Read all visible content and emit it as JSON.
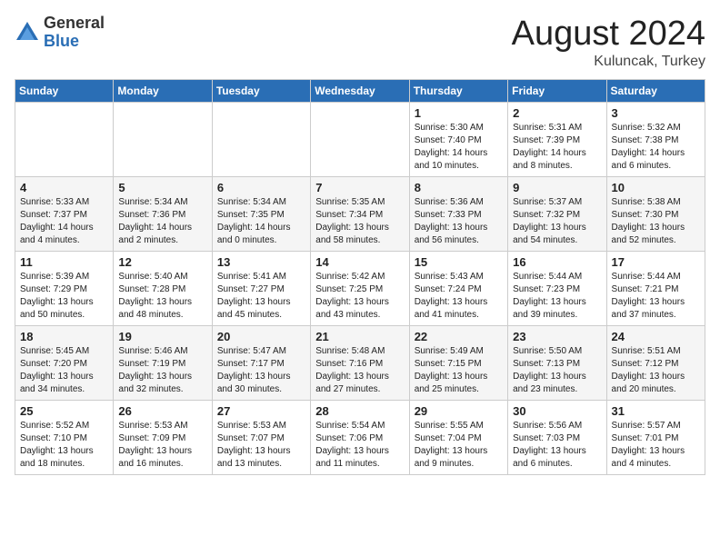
{
  "header": {
    "logo_general": "General",
    "logo_blue": "Blue",
    "month_year": "August 2024",
    "location": "Kuluncak, Turkey"
  },
  "days_of_week": [
    "Sunday",
    "Monday",
    "Tuesday",
    "Wednesday",
    "Thursday",
    "Friday",
    "Saturday"
  ],
  "weeks": [
    [
      {
        "day": "",
        "info": ""
      },
      {
        "day": "",
        "info": ""
      },
      {
        "day": "",
        "info": ""
      },
      {
        "day": "",
        "info": ""
      },
      {
        "day": "1",
        "info": "Sunrise: 5:30 AM\nSunset: 7:40 PM\nDaylight: 14 hours\nand 10 minutes."
      },
      {
        "day": "2",
        "info": "Sunrise: 5:31 AM\nSunset: 7:39 PM\nDaylight: 14 hours\nand 8 minutes."
      },
      {
        "day": "3",
        "info": "Sunrise: 5:32 AM\nSunset: 7:38 PM\nDaylight: 14 hours\nand 6 minutes."
      }
    ],
    [
      {
        "day": "4",
        "info": "Sunrise: 5:33 AM\nSunset: 7:37 PM\nDaylight: 14 hours\nand 4 minutes."
      },
      {
        "day": "5",
        "info": "Sunrise: 5:34 AM\nSunset: 7:36 PM\nDaylight: 14 hours\nand 2 minutes."
      },
      {
        "day": "6",
        "info": "Sunrise: 5:34 AM\nSunset: 7:35 PM\nDaylight: 14 hours\nand 0 minutes."
      },
      {
        "day": "7",
        "info": "Sunrise: 5:35 AM\nSunset: 7:34 PM\nDaylight: 13 hours\nand 58 minutes."
      },
      {
        "day": "8",
        "info": "Sunrise: 5:36 AM\nSunset: 7:33 PM\nDaylight: 13 hours\nand 56 minutes."
      },
      {
        "day": "9",
        "info": "Sunrise: 5:37 AM\nSunset: 7:32 PM\nDaylight: 13 hours\nand 54 minutes."
      },
      {
        "day": "10",
        "info": "Sunrise: 5:38 AM\nSunset: 7:30 PM\nDaylight: 13 hours\nand 52 minutes."
      }
    ],
    [
      {
        "day": "11",
        "info": "Sunrise: 5:39 AM\nSunset: 7:29 PM\nDaylight: 13 hours\nand 50 minutes."
      },
      {
        "day": "12",
        "info": "Sunrise: 5:40 AM\nSunset: 7:28 PM\nDaylight: 13 hours\nand 48 minutes."
      },
      {
        "day": "13",
        "info": "Sunrise: 5:41 AM\nSunset: 7:27 PM\nDaylight: 13 hours\nand 45 minutes."
      },
      {
        "day": "14",
        "info": "Sunrise: 5:42 AM\nSunset: 7:25 PM\nDaylight: 13 hours\nand 43 minutes."
      },
      {
        "day": "15",
        "info": "Sunrise: 5:43 AM\nSunset: 7:24 PM\nDaylight: 13 hours\nand 41 minutes."
      },
      {
        "day": "16",
        "info": "Sunrise: 5:44 AM\nSunset: 7:23 PM\nDaylight: 13 hours\nand 39 minutes."
      },
      {
        "day": "17",
        "info": "Sunrise: 5:44 AM\nSunset: 7:21 PM\nDaylight: 13 hours\nand 37 minutes."
      }
    ],
    [
      {
        "day": "18",
        "info": "Sunrise: 5:45 AM\nSunset: 7:20 PM\nDaylight: 13 hours\nand 34 minutes."
      },
      {
        "day": "19",
        "info": "Sunrise: 5:46 AM\nSunset: 7:19 PM\nDaylight: 13 hours\nand 32 minutes."
      },
      {
        "day": "20",
        "info": "Sunrise: 5:47 AM\nSunset: 7:17 PM\nDaylight: 13 hours\nand 30 minutes."
      },
      {
        "day": "21",
        "info": "Sunrise: 5:48 AM\nSunset: 7:16 PM\nDaylight: 13 hours\nand 27 minutes."
      },
      {
        "day": "22",
        "info": "Sunrise: 5:49 AM\nSunset: 7:15 PM\nDaylight: 13 hours\nand 25 minutes."
      },
      {
        "day": "23",
        "info": "Sunrise: 5:50 AM\nSunset: 7:13 PM\nDaylight: 13 hours\nand 23 minutes."
      },
      {
        "day": "24",
        "info": "Sunrise: 5:51 AM\nSunset: 7:12 PM\nDaylight: 13 hours\nand 20 minutes."
      }
    ],
    [
      {
        "day": "25",
        "info": "Sunrise: 5:52 AM\nSunset: 7:10 PM\nDaylight: 13 hours\nand 18 minutes."
      },
      {
        "day": "26",
        "info": "Sunrise: 5:53 AM\nSunset: 7:09 PM\nDaylight: 13 hours\nand 16 minutes."
      },
      {
        "day": "27",
        "info": "Sunrise: 5:53 AM\nSunset: 7:07 PM\nDaylight: 13 hours\nand 13 minutes."
      },
      {
        "day": "28",
        "info": "Sunrise: 5:54 AM\nSunset: 7:06 PM\nDaylight: 13 hours\nand 11 minutes."
      },
      {
        "day": "29",
        "info": "Sunrise: 5:55 AM\nSunset: 7:04 PM\nDaylight: 13 hours\nand 9 minutes."
      },
      {
        "day": "30",
        "info": "Sunrise: 5:56 AM\nSunset: 7:03 PM\nDaylight: 13 hours\nand 6 minutes."
      },
      {
        "day": "31",
        "info": "Sunrise: 5:57 AM\nSunset: 7:01 PM\nDaylight: 13 hours\nand 4 minutes."
      }
    ]
  ]
}
